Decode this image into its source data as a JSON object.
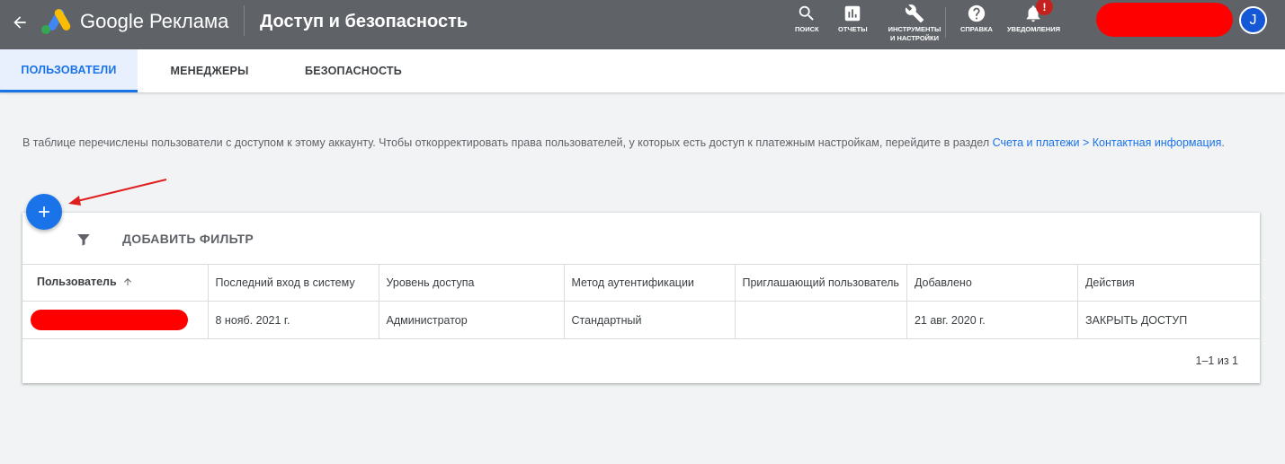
{
  "header": {
    "brand": "Google Реклама",
    "page_title": "Доступ и безопасность",
    "tools": [
      {
        "label": "ПОИСК",
        "icon": "search-icon"
      },
      {
        "label": "ОТЧЕТЫ",
        "icon": "reports-icon"
      },
      {
        "label": "ИНСТРУМЕНТЫ И НАСТРОЙКИ",
        "icon": "wrench-icon"
      },
      {
        "label": "СПРАВКА",
        "icon": "help-icon"
      },
      {
        "label": "УВЕДОМЛЕНИЯ",
        "icon": "bell-icon"
      }
    ],
    "notification_badge": "!",
    "avatar_initial": "J"
  },
  "tabs": [
    {
      "label": "ПОЛЬЗОВАТЕЛИ",
      "active": true
    },
    {
      "label": "МЕНЕДЖЕРЫ",
      "active": false
    },
    {
      "label": "БЕЗОПАСНОСТЬ",
      "active": false
    }
  ],
  "description": {
    "text": "В таблице перечислены пользователи с доступом к этому аккаунту. Чтобы откорректировать права пользователей, у которых есть доступ к платежным настройкам, перейдите в раздел ",
    "link": "Счета и платежи > Контактная информация",
    "end": "."
  },
  "filter": {
    "label": "ДОБАВИТЬ ФИЛЬТР"
  },
  "table": {
    "columns": [
      "Пользователь",
      "Последний вход в систему",
      "Уровень доступа",
      "Метод аутентификации",
      "Приглашающий пользователь",
      "Добавлено",
      "Действия"
    ],
    "rows": [
      {
        "user": "",
        "last_login": "8 нояб. 2021 г.",
        "access_level": "Администратор",
        "auth_method": "Стандартный",
        "inviter": "",
        "added": "21 авг. 2020 г.",
        "action": "ЗАКРЫТЬ ДОСТУП"
      }
    ]
  },
  "pagination": "1–1 из 1",
  "colors": {
    "header_bg": "#5f6368",
    "accent": "#1a73e8",
    "active_tab_bg": "#e8f0fe",
    "redaction": "#ff0000",
    "badge": "#c5221f",
    "annotation_arrow": "#e02020"
  }
}
